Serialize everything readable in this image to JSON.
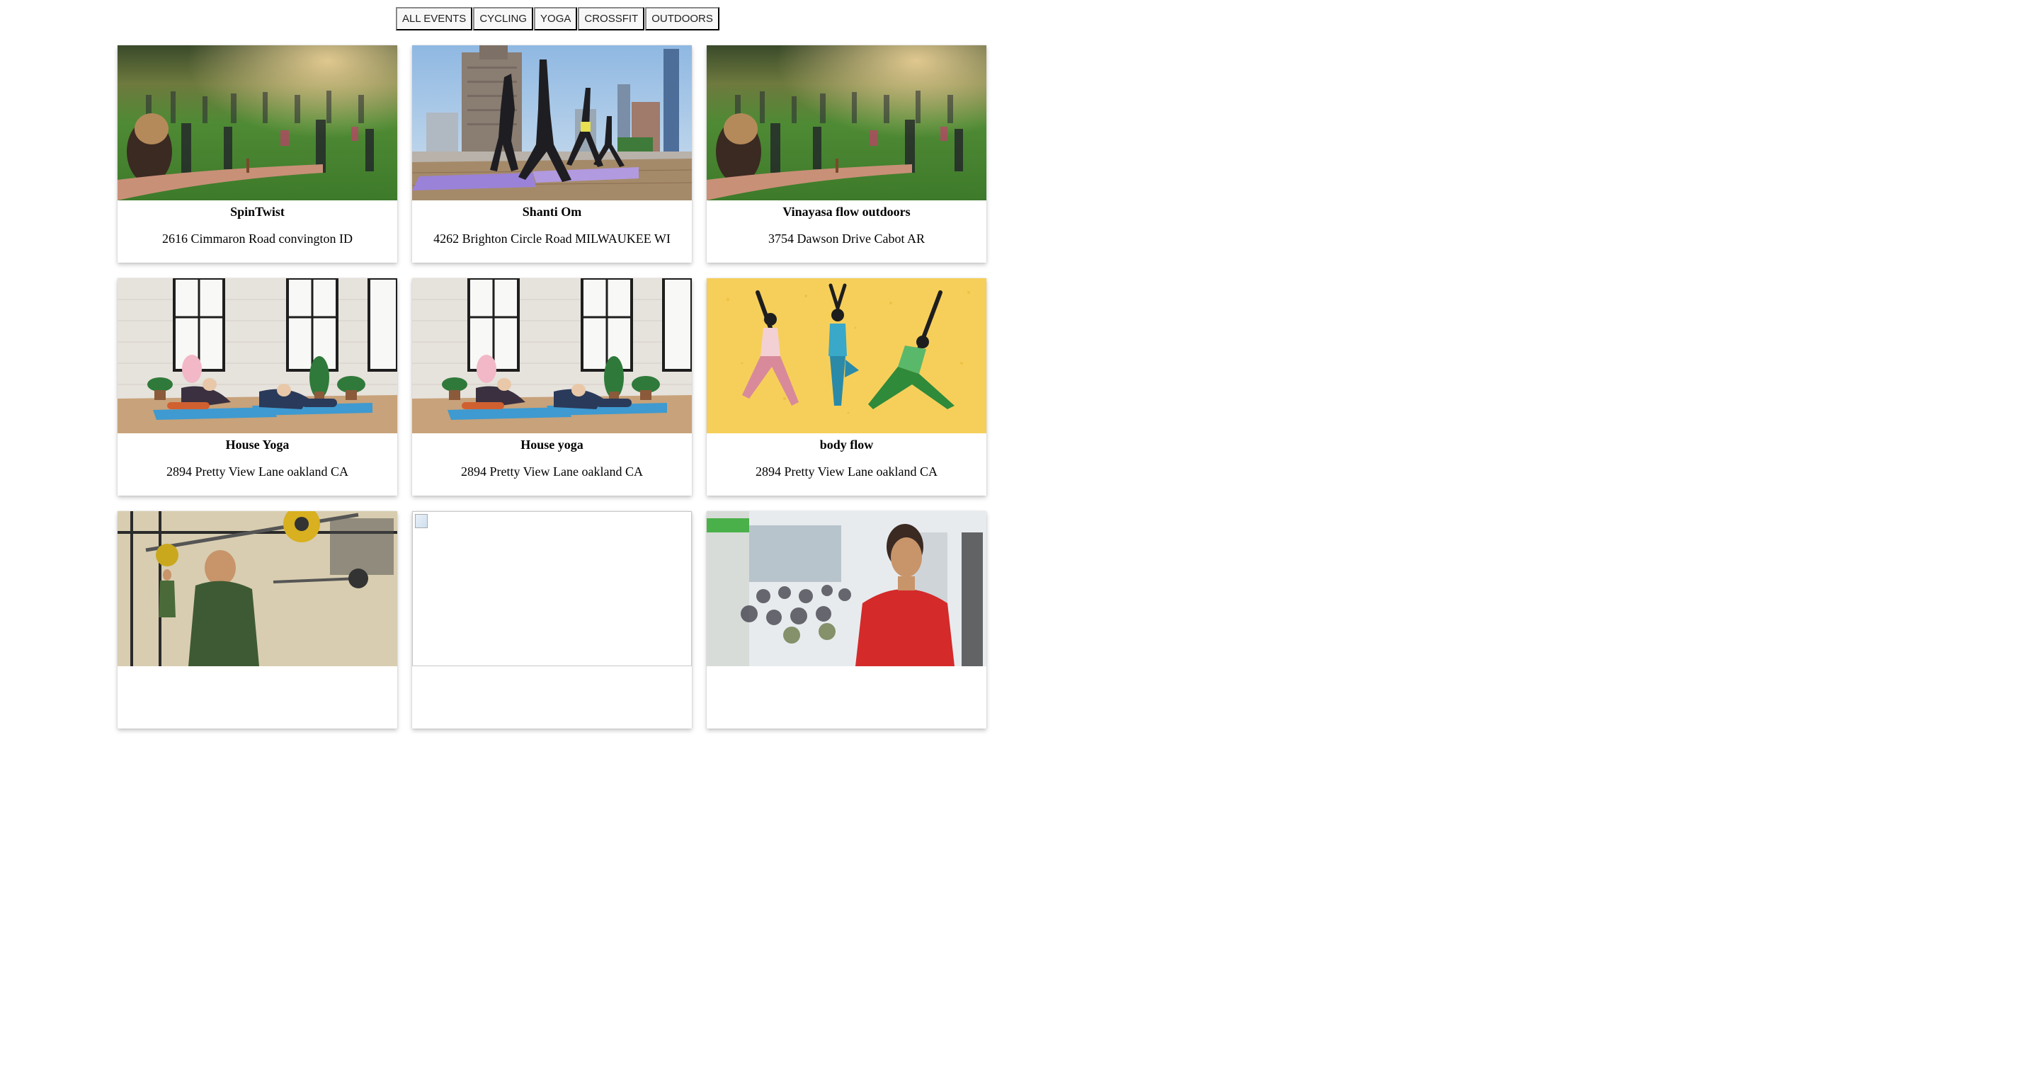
{
  "filters": [
    {
      "label": "ALL EVENTS"
    },
    {
      "label": "CYCLING"
    },
    {
      "label": "YOGA"
    },
    {
      "label": "CROSSFIT"
    },
    {
      "label": "OUTDOORS"
    }
  ],
  "events": [
    {
      "title": "SpinTwist",
      "address": "2616 Cimmaron Road convington ID",
      "image": "outdoor-yoga-park"
    },
    {
      "title": "Shanti Om",
      "address": "4262 Brighton Circle Road MILWAUKEE WI",
      "image": "rooftop-yoga-city"
    },
    {
      "title": "Vinayasa flow outdoors",
      "address": "3754 Dawson Drive Cabot AR",
      "image": "outdoor-yoga-park"
    },
    {
      "title": "House Yoga",
      "address": "2894 Pretty View Lane oakland CA",
      "image": "studio-yoga-stretch"
    },
    {
      "title": "House yoga",
      "address": "2894 Pretty View Lane oakland CA",
      "image": "studio-yoga-stretch"
    },
    {
      "title": "body flow",
      "address": "2894 Pretty View Lane oakland CA",
      "image": "yoga-illustration-yellow"
    },
    {
      "title": "",
      "address": "",
      "image": "crossfit-barbell-gym"
    },
    {
      "title": "",
      "address": "",
      "image": "broken-image"
    },
    {
      "title": "",
      "address": "",
      "image": "crossfit-class-coach"
    }
  ]
}
